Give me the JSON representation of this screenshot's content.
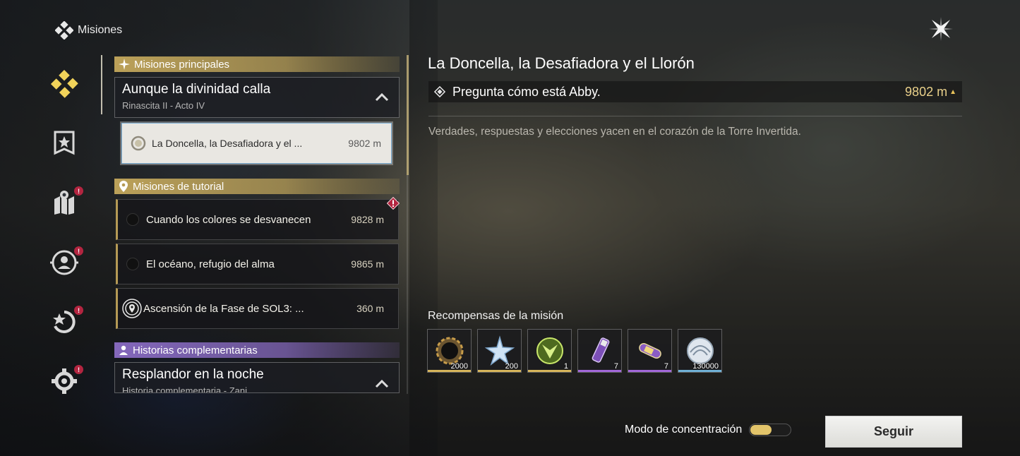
{
  "header": {
    "title": "Misiones",
    "icon": "quest-diamond-icon",
    "close_icon": "close-star-icon"
  },
  "nav": {
    "items": [
      {
        "name": "nav-quests",
        "icon": "diamond-cluster-icon",
        "active": true,
        "alert": false
      },
      {
        "name": "nav-main-story",
        "icon": "banner-shield-icon",
        "alert": false
      },
      {
        "name": "nav-exploration",
        "icon": "map-pin-icon",
        "alert": true
      },
      {
        "name": "nav-characters",
        "icon": "person-target-icon",
        "alert": true
      },
      {
        "name": "nav-events",
        "icon": "star-refresh-icon",
        "alert": true
      },
      {
        "name": "nav-settings",
        "icon": "gear-icon",
        "alert": true
      }
    ],
    "alert_symbol": "!"
  },
  "sections": {
    "main": {
      "label": "Misiones principales",
      "chapter": {
        "name": "Aunque la divinidad calla",
        "sub": "Rinascita II - Acto IV"
      },
      "active_quest": {
        "name": "La Doncella, la Desafiadora y el ...",
        "distance": "9802 m"
      }
    },
    "tutorial": {
      "label": "Misiones de tutorial",
      "quests": [
        {
          "name": "Cuando los colores se desvanecen",
          "distance": "9828 m"
        },
        {
          "name": "El océano, refugio del alma",
          "distance": "9865 m"
        },
        {
          "name": "Ascensión de la Fase de SOL3: ...",
          "distance": "360 m"
        }
      ]
    },
    "side": {
      "label": "Historias complementarias",
      "chapter": {
        "name": "Resplandor en la noche",
        "sub": "Historia complementaria - Zani"
      }
    }
  },
  "detail": {
    "title": "La Doncella, la Desafiadora y el Llorón",
    "objective": {
      "text": "Pregunta cómo está Abby.",
      "distance": "9802 m",
      "arrow": "▲"
    },
    "description": "Verdades, respuestas y elecciones yacen en el corazón de la Torre Invertida.",
    "rewards_title": "Recompensas de la misión",
    "rewards": [
      {
        "icon": "dark-gear-orb-icon",
        "qty": "2000",
        "rarity_color": "#d6b45a"
      },
      {
        "icon": "crystal-star-icon",
        "qty": "200",
        "rarity_color": "#d6b45a"
      },
      {
        "icon": "green-emblem-icon",
        "qty": "1",
        "rarity_color": "#d6b45a"
      },
      {
        "icon": "purple-vial-icon",
        "qty": "7",
        "rarity_color": "#a167d8"
      },
      {
        "icon": "purple-capsule-icon",
        "qty": "7",
        "rarity_color": "#a167d8"
      },
      {
        "icon": "shell-coin-icon",
        "qty": "130000",
        "rarity_color": "#6fb0d6"
      }
    ]
  },
  "footer": {
    "focus_label": "Modo de concentración",
    "focus_on": true,
    "follow_label": "Seguir"
  }
}
